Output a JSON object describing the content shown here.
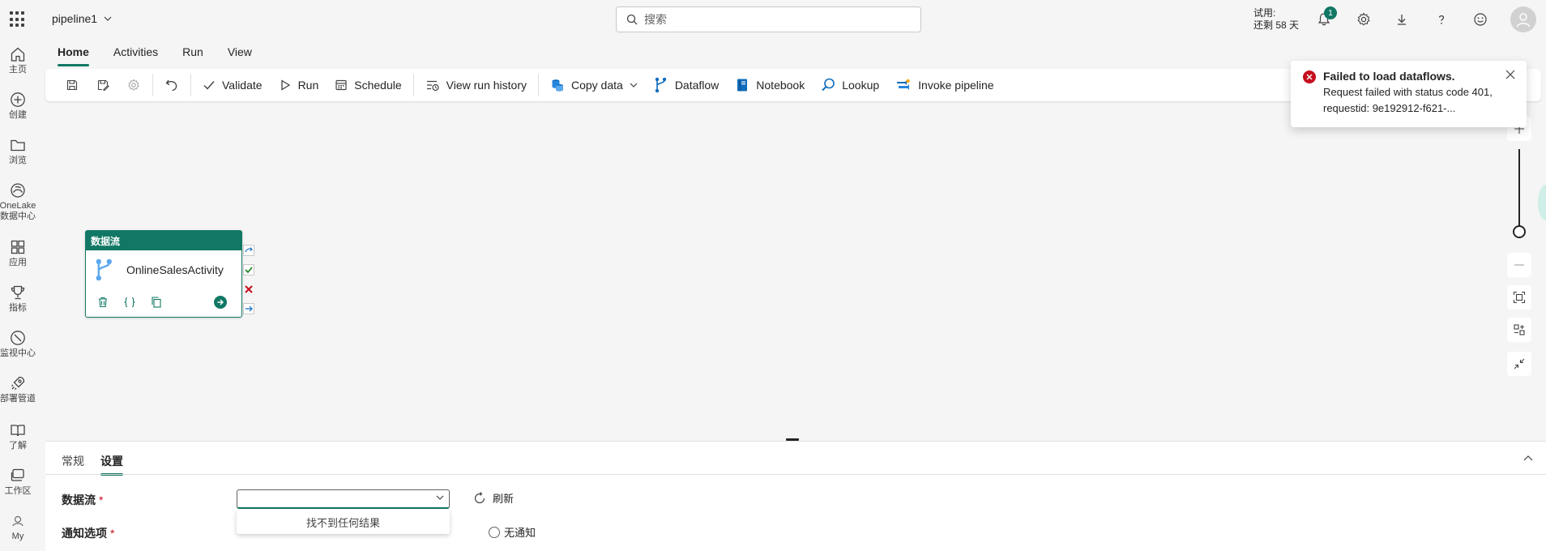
{
  "header": {
    "app_title": "pipeline1",
    "search_placeholder": "搜索",
    "trial_line1": "试用:",
    "trial_line2": "还剩 58 天",
    "notification_count": "1"
  },
  "rail": [
    {
      "label": "主页",
      "icon": "home-icon"
    },
    {
      "label": "创建",
      "icon": "create-icon"
    },
    {
      "label": "浏览",
      "icon": "browse-icon"
    },
    {
      "label": "OneLake\n数据中心",
      "icon": "onelake-icon"
    },
    {
      "label": "应用",
      "icon": "apps-icon"
    },
    {
      "label": "指标",
      "icon": "metrics-icon"
    },
    {
      "label": "监视中心",
      "icon": "monitor-icon"
    },
    {
      "label": "部署管道",
      "icon": "deployment-icon"
    },
    {
      "label": "了解",
      "icon": "learn-icon"
    },
    {
      "label": "工作区",
      "icon": "workspaces-icon"
    },
    {
      "label": "My",
      "icon": "my-workspace-icon"
    }
  ],
  "ribbon": {
    "tabs": [
      "Home",
      "Activities",
      "Run",
      "View"
    ],
    "active_tab": "Home"
  },
  "toolbar": {
    "validate": "Validate",
    "run": "Run",
    "schedule": "Schedule",
    "view_run_history": "View run history",
    "copy_data": "Copy data",
    "dataflow": "Dataflow",
    "notebook": "Notebook",
    "lookup": "Lookup",
    "invoke_pipeline": "Invoke pipeline"
  },
  "activity": {
    "type_label": "数据流",
    "name": "OnlineSalesActivity"
  },
  "toast": {
    "title": "Failed to load dataflows.",
    "message": "Request failed with status code 401, requestid: 9e192912-f621-..."
  },
  "panel": {
    "tabs": [
      "常规",
      "设置"
    ],
    "active_tab": "设置",
    "dataflow_label": "数据流",
    "notify_label": "通知选项",
    "required_mark": "*",
    "dropdown_empty": "找不到任何结果",
    "refresh": "刷新",
    "no_notify": "无通知"
  },
  "colors": {
    "accent": "#117865",
    "error": "#c50f1f"
  }
}
